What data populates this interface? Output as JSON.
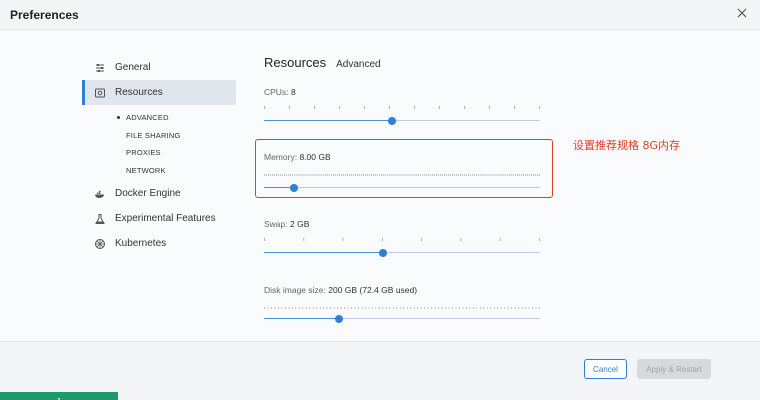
{
  "window": {
    "title": "Preferences"
  },
  "sidebar": {
    "items": [
      {
        "label": "General",
        "icon": "sliders-icon"
      },
      {
        "label": "Resources",
        "icon": "resources-icon"
      },
      {
        "label": "Docker Engine",
        "icon": "whale-icon"
      },
      {
        "label": "Experimental Features",
        "icon": "flask-icon"
      },
      {
        "label": "Kubernetes",
        "icon": "helm-wheel-icon"
      }
    ],
    "resources_sub": [
      "ADVANCED",
      "FILE SHARING",
      "PROXIES",
      "NETWORK"
    ]
  },
  "tabs": {
    "resources": "Resources",
    "advanced": "Advanced"
  },
  "settings": {
    "cpus": {
      "label": "CPUs:",
      "value": "8",
      "position": 0.465
    },
    "memory": {
      "label": "Memory:",
      "value": "8.00 GB",
      "position": 0.11
    },
    "swap": {
      "label": "Swap:",
      "value": "2 GB",
      "position": 0.43
    },
    "disk": {
      "label": "Disk image size:",
      "value": "200 GB (72.4 GB used)",
      "position": 0.27
    }
  },
  "annotation": {
    "text": "设置推荐规格 8G内存",
    "color": "#e0402a"
  },
  "footer": {
    "cancel": "Cancel",
    "apply": "Apply & Restart"
  },
  "colors": {
    "accent": "#2f7ed8",
    "status_bar": "#1f9a6b"
  }
}
